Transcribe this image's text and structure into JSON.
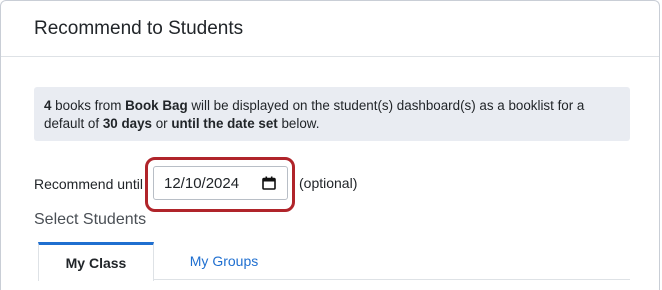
{
  "modal": {
    "title": "Recommend to Students"
  },
  "info": {
    "count": "4",
    "text1": " books from ",
    "source": "Book Bag",
    "text2": " will be displayed on the student(s) dashboard(s) as a booklist for a default of ",
    "days": "30 days",
    "text3": " or ",
    "until": "until the date set",
    "text4": " below."
  },
  "recommend": {
    "label": "Recommend until",
    "date_value": "12/10/2024",
    "optional": "(optional)"
  },
  "students": {
    "heading": "Select Students",
    "tabs": [
      {
        "label": "My Class",
        "active": true
      },
      {
        "label": "My Groups",
        "active": false
      }
    ]
  },
  "colors": {
    "highlight": "#b0242a",
    "accent": "#1f6fd0"
  },
  "icons": {
    "date": "calendar-icon"
  }
}
